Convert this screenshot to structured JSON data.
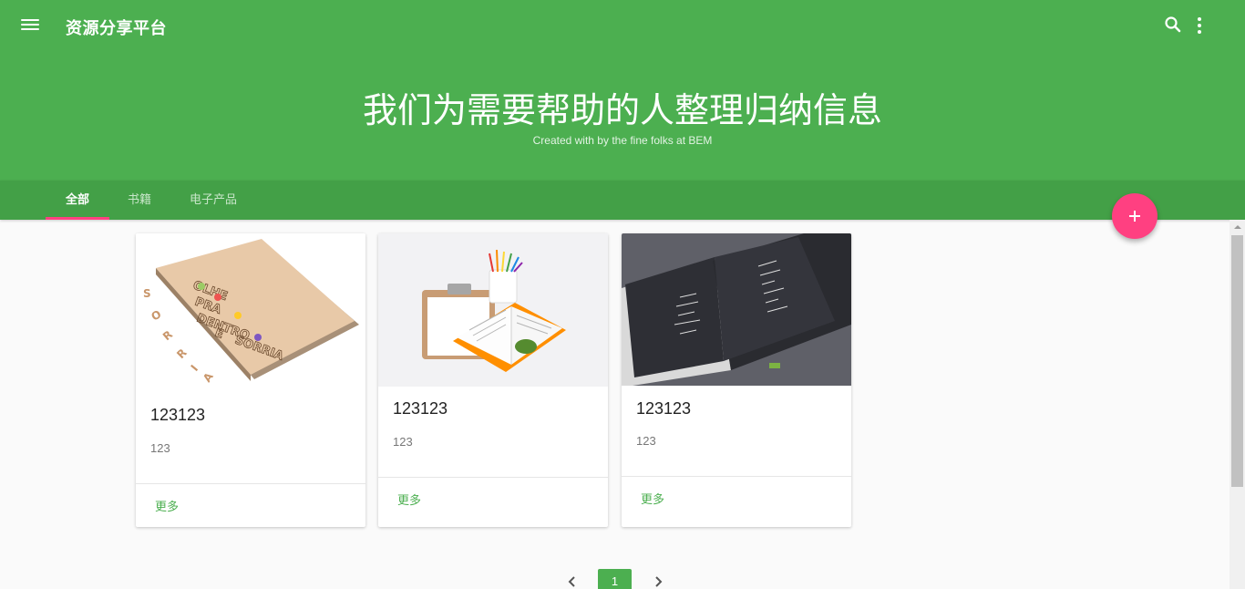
{
  "appbar": {
    "title": "资源分享平台",
    "hero_title": "我们为需要帮助的人整理归纳信息",
    "hero_subtitle": "Created with by the fine folks at BEM",
    "icons": {
      "menu": "menu-icon",
      "search": "search-icon",
      "more": "more-vert-icon"
    }
  },
  "tabs": [
    {
      "label": "全部",
      "active": true
    },
    {
      "label": "书籍",
      "active": false
    },
    {
      "label": "电子产品",
      "active": false
    }
  ],
  "fab": {
    "icon": "plus-icon"
  },
  "cards": [
    {
      "title": "123123",
      "description": "123",
      "action": "更多"
    },
    {
      "title": "123123",
      "description": "123",
      "action": "更多"
    },
    {
      "title": "123123",
      "description": "123",
      "action": "更多"
    }
  ],
  "pagination": {
    "current_page": "1",
    "prev_icon": "chevron-left-icon",
    "next_icon": "chevron-right-icon"
  },
  "colors": {
    "primary": "#4caf50",
    "primary_dark": "#43a047",
    "accent": "#ff4081"
  }
}
